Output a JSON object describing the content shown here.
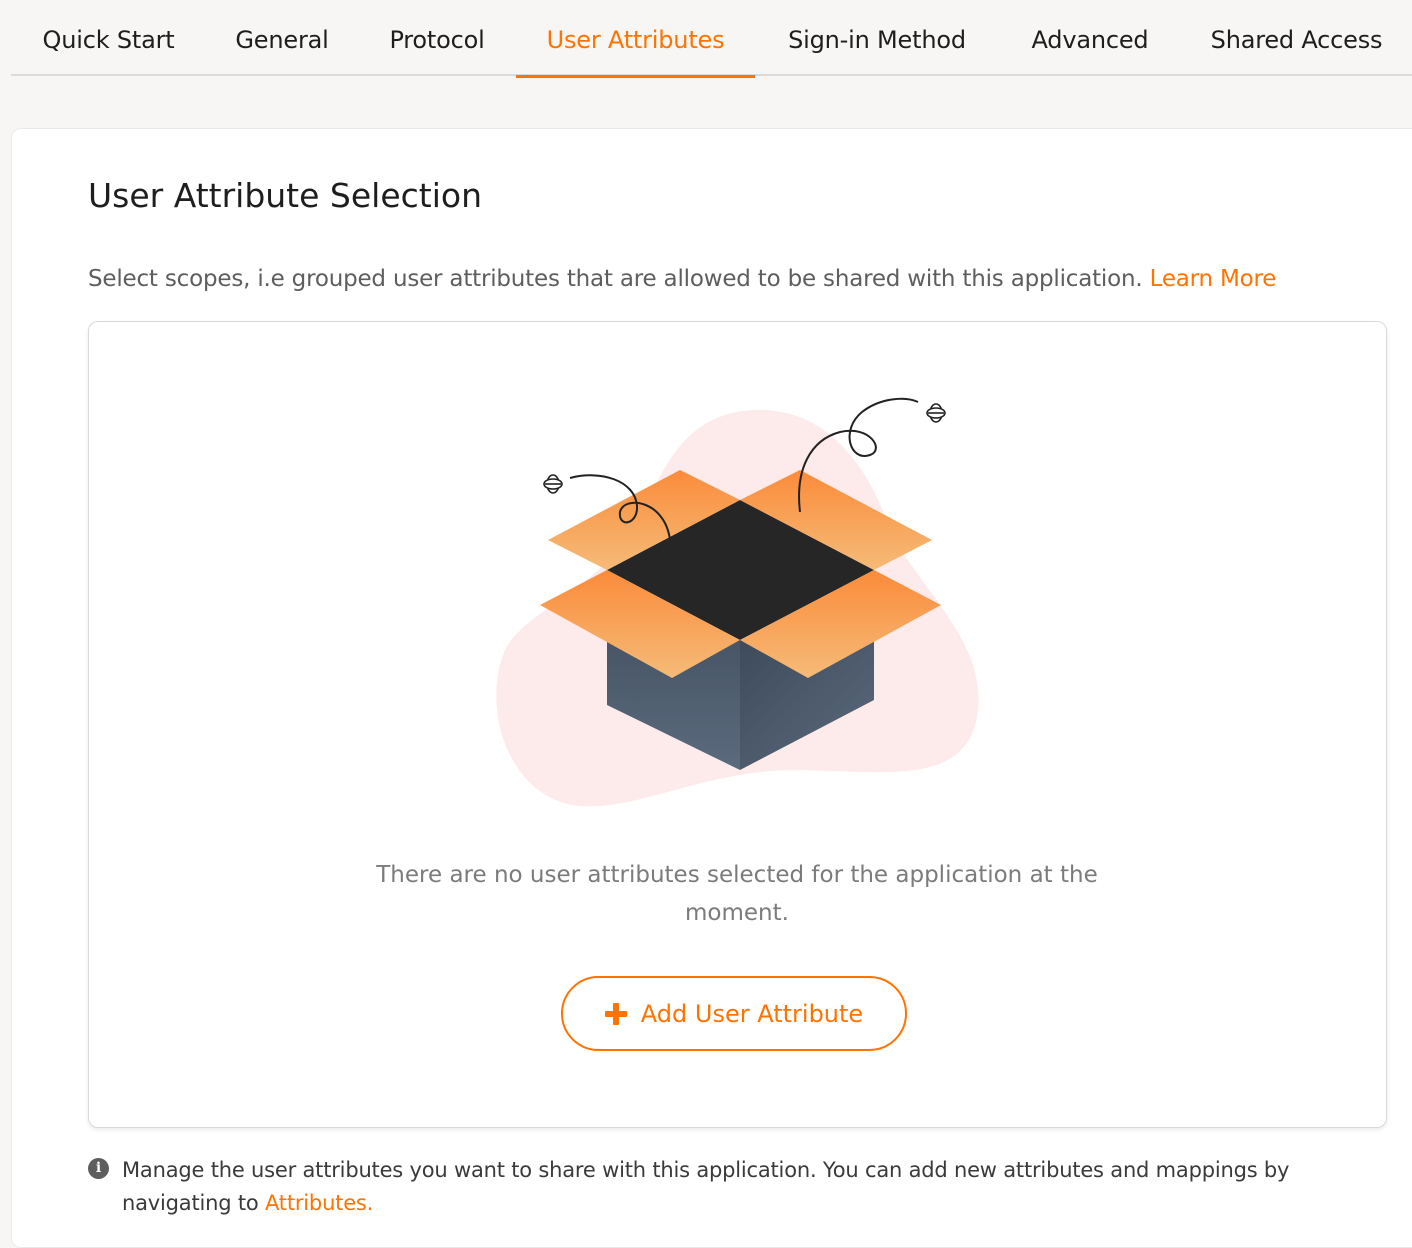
{
  "tabs": [
    {
      "label": "Quick Start"
    },
    {
      "label": "General"
    },
    {
      "label": "Protocol"
    },
    {
      "label": "User Attributes",
      "active": true
    },
    {
      "label": "Sign-in Method"
    },
    {
      "label": "Advanced"
    },
    {
      "label": "Shared Access"
    }
  ],
  "section": {
    "title": "User Attribute Selection",
    "hint": "Select scopes, i.e grouped user attributes that are allowed to be shared with this application.",
    "learn_more": "Learn More"
  },
  "empty_state": {
    "illustration": "open-box-icon",
    "message": "There are no user attributes selected for the application at the moment.",
    "add_button_label": "Add User Attribute",
    "add_button_icon": "plus-icon"
  },
  "info": {
    "icon": "info-icon",
    "text": "Manage the user attributes you want to share with this application. You can add new attributes and mappings by navigating to",
    "link": "Attributes."
  },
  "colors": {
    "accent": "#ff7300",
    "box_dark": "#262626",
    "box_side": "#4f5d6e",
    "blob": "#fdeaea"
  }
}
